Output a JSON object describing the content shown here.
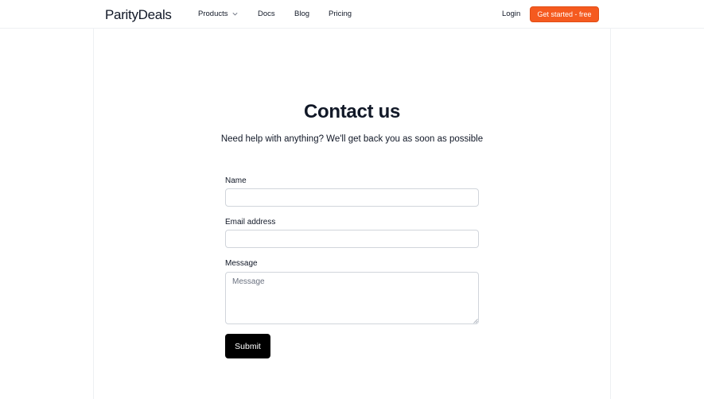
{
  "header": {
    "logo": "ParityDeals",
    "nav": {
      "products": "Products",
      "docs": "Docs",
      "blog": "Blog",
      "pricing": "Pricing"
    },
    "login": "Login",
    "cta": "Get started - free"
  },
  "main": {
    "title": "Contact us",
    "subtitle": "Need help with anything? We'll get back you as soon as possible",
    "form": {
      "name_label": "Name",
      "name_value": "",
      "email_label": "Email address",
      "email_value": "",
      "message_label": "Message",
      "message_placeholder": "Message",
      "submit_label": "Submit"
    }
  },
  "colors": {
    "accent": "#f55a1f",
    "text": "#111827",
    "submit_bg": "#000000"
  }
}
